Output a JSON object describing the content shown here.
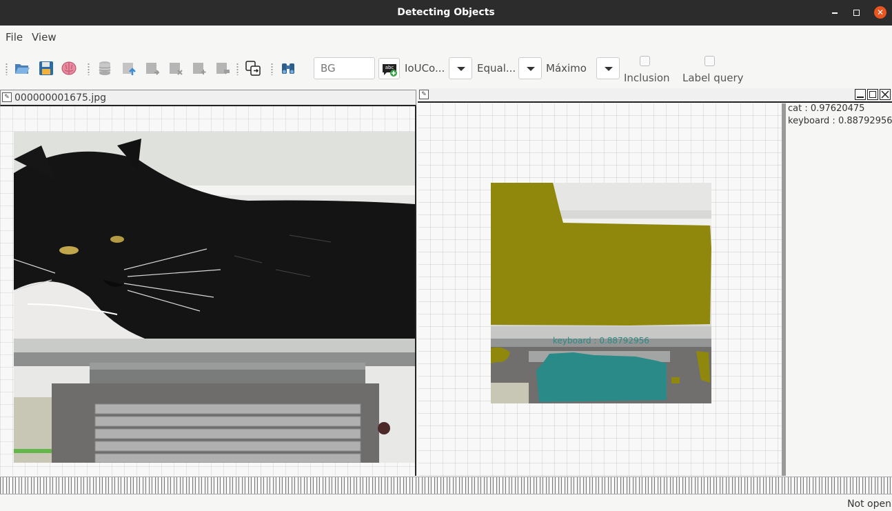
{
  "window": {
    "title": "Detecting Objects"
  },
  "menu": [
    "File",
    "View"
  ],
  "toolbar": {
    "class_field_value": "BG",
    "dropdown1_label": "IoUCo...",
    "dropdown2_label": "Equal...",
    "dropdown3_label": "Máximo",
    "check1_label": "Inclusion",
    "check2_label": "Label query"
  },
  "left_panel": {
    "title": "000000001675.jpg"
  },
  "right_panel": {
    "overlay_label": "keyboard : 0.88792956",
    "results": [
      "cat : 0.97620475",
      "keyboard : 0.88792956"
    ]
  },
  "status": {
    "text": "Not open"
  },
  "colors": {
    "cat_mask": "#8f880c",
    "keyboard_mask": "#2a8a88",
    "accent": "#e95420"
  }
}
